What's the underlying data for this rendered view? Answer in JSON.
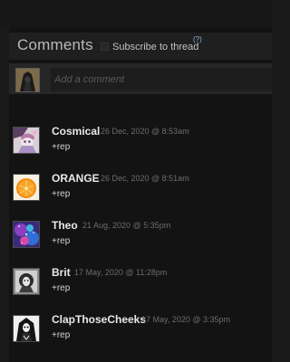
{
  "header": {
    "title": "Comments",
    "subscribe_label": "Subscribe to thread",
    "help_label": "(?)"
  },
  "compose": {
    "placeholder": "Add a comment"
  },
  "comments": [
    {
      "author": "Cosmical",
      "timestamp": "26 Dec, 2020 @ 8:53am",
      "text": "+rep",
      "avatar_icon": "anime-character-avatar"
    },
    {
      "author": "ORANGE",
      "timestamp": "26 Dec, 2020 @ 8:51am",
      "text": "+rep",
      "avatar_icon": "orange-fruit-avatar"
    },
    {
      "author": "Theo",
      "timestamp": "21 Aug, 2020 @ 5:35pm",
      "text": "+rep",
      "avatar_icon": "galaxy-avatar"
    },
    {
      "author": "Brit",
      "timestamp": "17 May, 2020 @ 11:28pm",
      "text": "+rep",
      "avatar_icon": "portrait-sketch-avatar"
    },
    {
      "author": "ClapThoseCheeks",
      "timestamp": "17 May, 2020 @ 3:35pm",
      "text": "+rep",
      "avatar_icon": "hooded-figure-avatar"
    }
  ],
  "colors": {
    "background": "#1a1a1a",
    "panel": "#131313",
    "author": "#e8e8e8",
    "timestamp": "#6c6c6c",
    "link": "#8fb4e0"
  }
}
